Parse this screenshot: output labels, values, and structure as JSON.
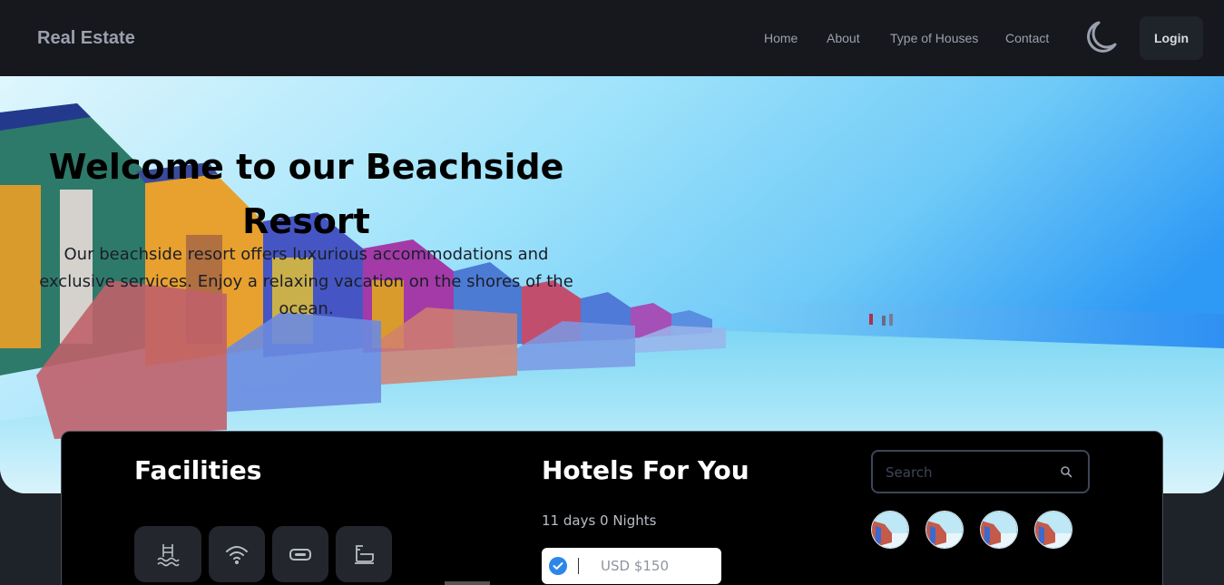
{
  "header": {
    "brand": "Real Estate",
    "nav": [
      "Home",
      "About",
      "Type of Houses",
      "Contact"
    ],
    "theme_toggle_icon": "moon-icon",
    "login_label": "Login"
  },
  "hero": {
    "title": "Welcome to our Beachside Resort",
    "description": "Our beachside resort offers luxurious accommodations and exclusive services. Enjoy a relaxing vacation on the shores of the ocean."
  },
  "facilities": {
    "title": "Facilities",
    "icons": [
      "pool-icon",
      "wifi-icon",
      "parking-icon",
      "bath-icon"
    ]
  },
  "hotels": {
    "title": "Hotels For You",
    "stay": "11 days 0 Nights",
    "price": "USD $150"
  },
  "search": {
    "placeholder": "Search"
  },
  "colors": {
    "nav_bg": "#16181d",
    "page_bg": "#1e2229",
    "panel_bg": "#000000",
    "accent": "#2c87e8"
  }
}
